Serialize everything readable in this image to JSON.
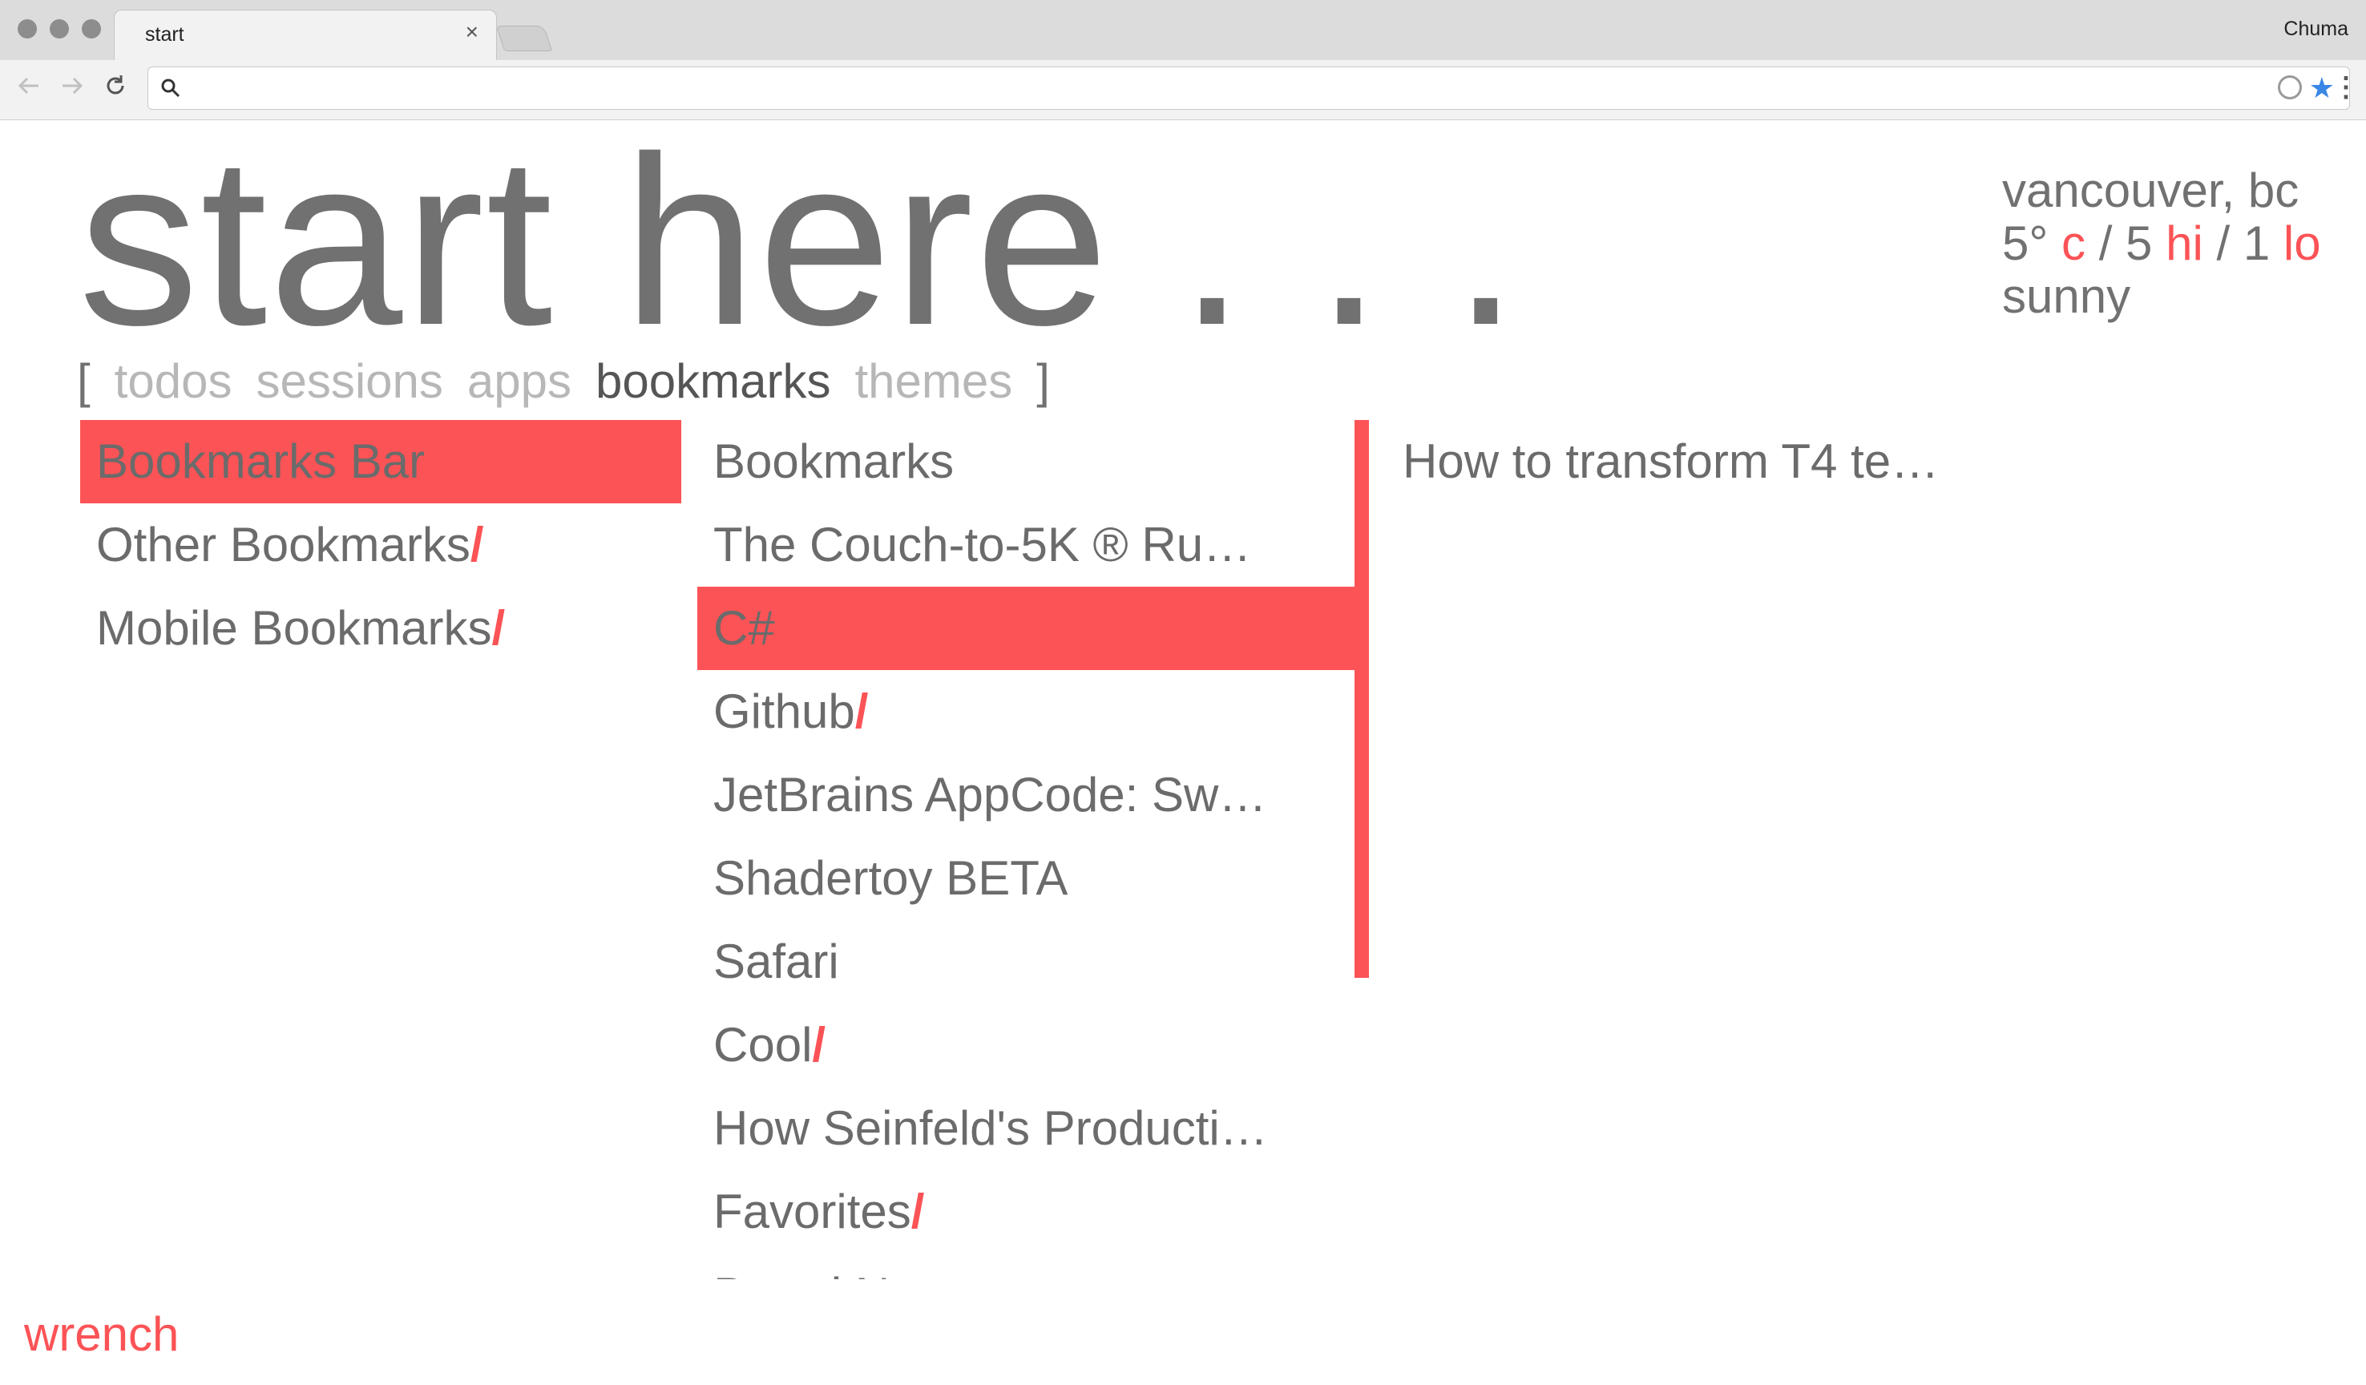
{
  "colors": {
    "accent": "#fc5356",
    "text": "#717171",
    "muted": "#b7b7b7",
    "chrome": "#dcdcdc"
  },
  "browser": {
    "tab_title": "start",
    "tab_close": "×",
    "profile_name": "Chuma",
    "omnibox": {
      "value": "",
      "placeholder": ""
    },
    "icons": [
      "back-arrow-icon",
      "forward-arrow-icon",
      "reload-icon",
      "search-icon",
      "bookmark-star-icon",
      "extension-icon",
      "menu-icon"
    ]
  },
  "page": {
    "title": "start here . . .",
    "weather": {
      "location": "vancouver, bc",
      "temp": "5°",
      "unit": "c",
      "hi_value": "/ 5",
      "hi_label": "hi",
      "lo_value": "/ 1",
      "lo_label": "lo",
      "condition": "sunny"
    },
    "menu": {
      "open_bracket": "[",
      "close_bracket": "]",
      "tabs": [
        {
          "label": "todos",
          "active": false
        },
        {
          "label": "sessions",
          "active": false
        },
        {
          "label": "apps",
          "active": false
        },
        {
          "label": "bookmarks",
          "active": true
        },
        {
          "label": "themes",
          "active": false
        }
      ]
    },
    "folder_marker": "/",
    "columns": {
      "roots": [
        {
          "label": "Bookmarks Bar",
          "folder": false,
          "selected": true
        },
        {
          "label": "Other Bookmarks",
          "folder": true,
          "selected": false
        },
        {
          "label": "Mobile Bookmarks",
          "folder": true,
          "selected": false
        }
      ],
      "bookmarks_bar": [
        {
          "label": "Bookmarks",
          "folder": false,
          "selected": false
        },
        {
          "label": "The Couch-to-5K ® Ru…",
          "folder": false,
          "selected": false
        },
        {
          "label": "C#",
          "folder": false,
          "selected": true
        },
        {
          "label": "Github",
          "folder": true,
          "selected": false
        },
        {
          "label": "JetBrains AppCode: Sw…",
          "folder": false,
          "selected": false
        },
        {
          "label": "Shadertoy BETA",
          "folder": false,
          "selected": false
        },
        {
          "label": "Safari",
          "folder": false,
          "selected": false
        },
        {
          "label": "Cool",
          "folder": true,
          "selected": false
        },
        {
          "label": "How Seinfeld's Producti…",
          "folder": false,
          "selected": false
        },
        {
          "label": "Favorites",
          "folder": true,
          "selected": false
        },
        {
          "label": "Board N…",
          "folder": false,
          "selected": false
        }
      ],
      "csharp": [
        {
          "label": "How to transform T4 te…",
          "folder": false,
          "selected": false
        }
      ]
    },
    "footer": {
      "wrench": "wrench"
    }
  }
}
